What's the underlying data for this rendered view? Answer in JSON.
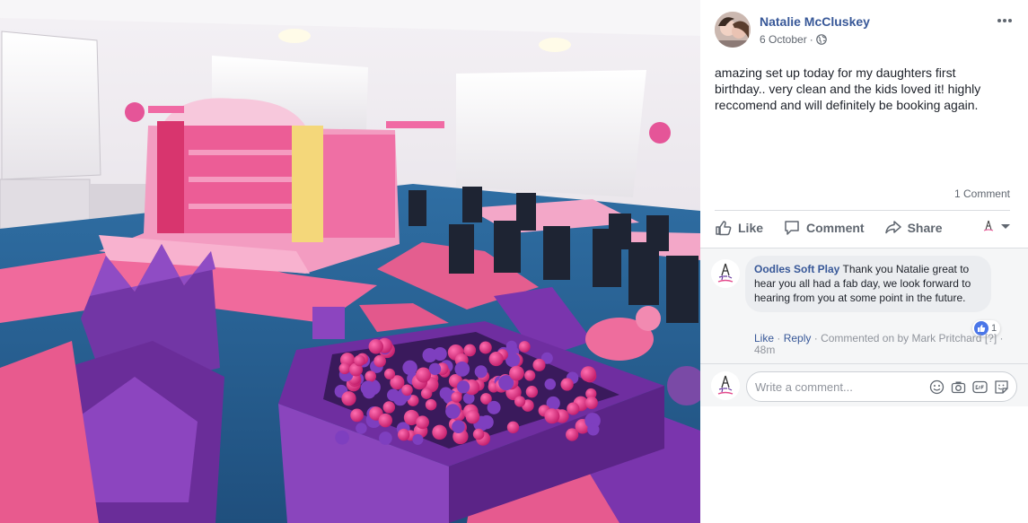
{
  "post": {
    "author": "Natalie McCluskey",
    "date": "6 October",
    "separator": "·",
    "text": "amazing set up today for my daughters first birthday.. very clean and the kids loved it! highly reccomend and will definitely be booking again.",
    "comment_count": "1 Comment"
  },
  "actions": {
    "like": "Like",
    "comment": "Comment",
    "share": "Share"
  },
  "comment": {
    "author": "Oodles Soft Play",
    "text": "Thank you Natalie great to hear you all had a fab day, we look forward to hearing from you at some point in the future.",
    "reaction_count": "1",
    "like_link": "Like",
    "reply_link": "Reply",
    "commented_on_by": "Commented on by Mark Pritchard [?]",
    "time": "48m"
  },
  "composer": {
    "placeholder": "Write a comment..."
  },
  "icons": [
    "globe-icon",
    "more-icon",
    "like-icon",
    "comment-icon",
    "share-icon",
    "caret-down-icon",
    "emoji-icon",
    "camera-icon",
    "gif-icon",
    "sticker-icon"
  ],
  "colors": {
    "link": "#385898",
    "muted": "#606770",
    "like_blue": "#4a76e8",
    "bubble": "#ebedf0"
  }
}
